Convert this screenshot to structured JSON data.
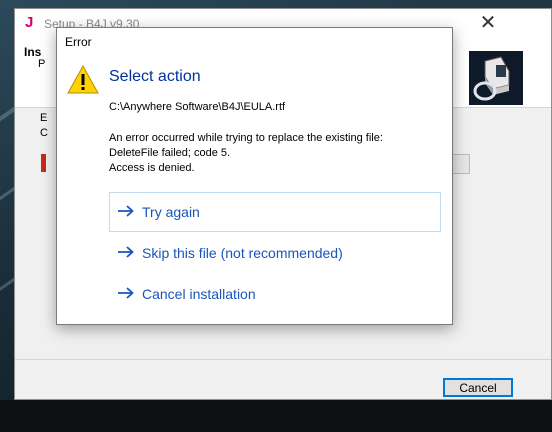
{
  "setup_window": {
    "app_icon": "J",
    "title": "Setup - B4J v9.30",
    "clipped_header": [
      "Ins",
      "P"
    ],
    "clipped_body": [
      "E",
      "C"
    ],
    "cancel_button": "Cancel"
  },
  "error_dialog": {
    "title": "Error",
    "instruction": "Select action",
    "file_path": "C:\\Anywhere Software\\B4J\\EULA.rtf",
    "message_lines": [
      "An error occurred while trying to replace the existing file:",
      "DeleteFile failed; code 5.",
      "Access is denied."
    ],
    "actions": [
      {
        "label": "Try again"
      },
      {
        "label": "Skip this file (not recommended)"
      },
      {
        "label": "Cancel installation"
      }
    ]
  },
  "colors": {
    "instruction": "#003399",
    "link": "#1a56b8",
    "accent": "#0078d7"
  }
}
